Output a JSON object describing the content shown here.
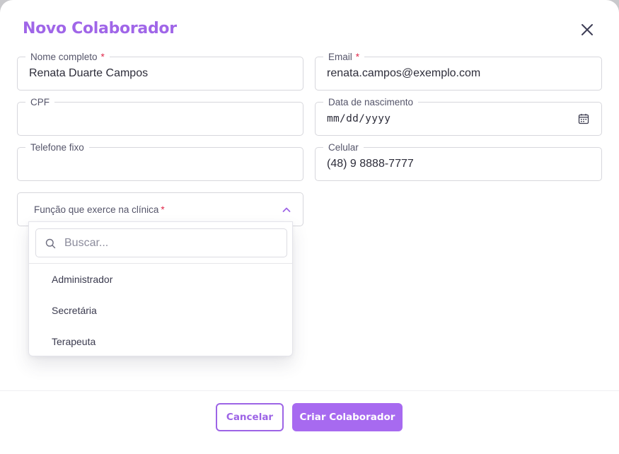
{
  "modal": {
    "title": "Novo Colaborador",
    "close_icon": "close-icon"
  },
  "fields": {
    "nome": {
      "label": "Nome completo",
      "required": "*",
      "value": "Renata Duarte Campos"
    },
    "email": {
      "label": "Email",
      "required": "*",
      "value": "renata.campos@exemplo.com"
    },
    "cpf": {
      "label": "CPF",
      "value": ""
    },
    "nascimento": {
      "label": "Data de nascimento",
      "value": "mm/dd/yyyy",
      "icon": "calendar-icon"
    },
    "telefone": {
      "label": "Telefone fixo",
      "value": ""
    },
    "celular": {
      "label": "Celular",
      "value": "(48) 9 8888-7777"
    }
  },
  "funcao": {
    "label": "Função que exerce na clínica",
    "required": "*",
    "icon": "chevron-up-icon",
    "search_placeholder": "Buscar...",
    "options": [
      "Administrador",
      "Secretária",
      "Terapeuta"
    ]
  },
  "footer": {
    "cancel_label": "Cancelar",
    "create_label": "Criar Colaborador"
  },
  "colors": {
    "accent": "#a066e8",
    "required": "#e0284a"
  }
}
